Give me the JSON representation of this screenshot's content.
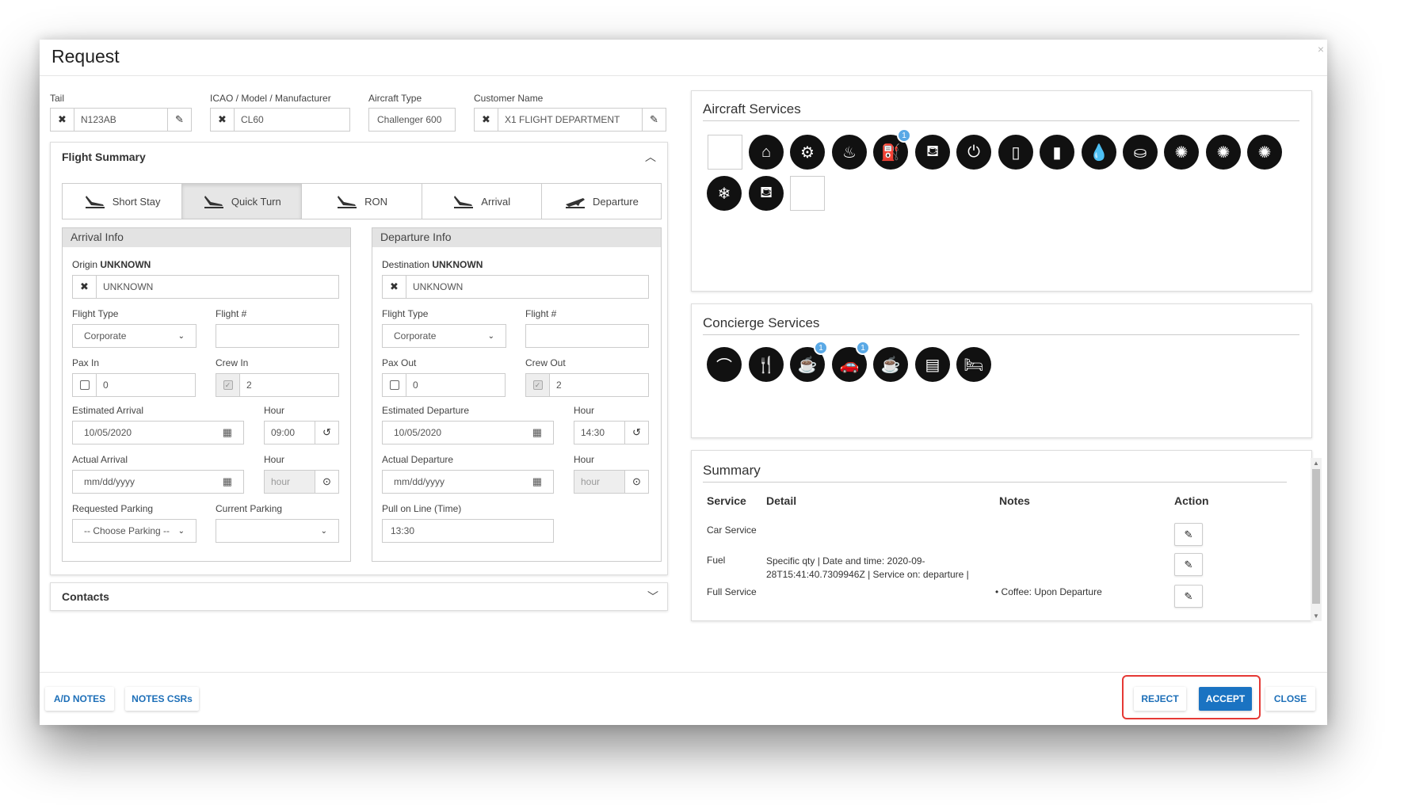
{
  "modal": {
    "title": "Request"
  },
  "top_fields": {
    "tail": {
      "label": "Tail",
      "value": "N123AB"
    },
    "icao": {
      "label": "ICAO / Model / Manufacturer",
      "value": "CL60"
    },
    "aircraft_type": {
      "label": "Aircraft Type",
      "value": "Challenger 600"
    },
    "customer": {
      "label": "Customer Name",
      "value": "X1 FLIGHT DEPARTMENT"
    }
  },
  "flight_summary": {
    "title": "Flight Summary",
    "tabs": [
      {
        "label": "Short Stay"
      },
      {
        "label": "Quick Turn"
      },
      {
        "label": "RON"
      },
      {
        "label": "Arrival"
      },
      {
        "label": "Departure"
      }
    ]
  },
  "arrival": {
    "title": "Arrival Info",
    "origin_label": "Origin",
    "origin_value": "UNKNOWN",
    "origin_input": "UNKNOWN",
    "flight_type_label": "Flight Type",
    "flight_type_value": "Corporate",
    "flight_no_label": "Flight #",
    "pax_label": "Pax In",
    "pax_value": "0",
    "crew_label": "Crew In",
    "crew_value": "2",
    "est_label": "Estimated Arrival",
    "est_value": "10/05/2020",
    "est_hour_label": "Hour",
    "est_hour_value": "09:00",
    "act_label": "Actual Arrival",
    "act_placeholder": "mm/dd/yyyy",
    "act_hour_label": "Hour",
    "act_hour_placeholder": "hour",
    "req_parking_label": "Requested Parking",
    "req_parking_value": "-- Choose Parking --",
    "cur_parking_label": "Current Parking"
  },
  "departure": {
    "title": "Departure Info",
    "dest_label": "Destination",
    "dest_value": "UNKNOWN",
    "dest_input": "UNKNOWN",
    "flight_type_label": "Flight Type",
    "flight_type_value": "Corporate",
    "flight_no_label": "Flight #",
    "pax_label": "Pax Out",
    "pax_value": "0",
    "crew_label": "Crew Out",
    "crew_value": "2",
    "est_label": "Estimated Departure",
    "est_value": "10/05/2020",
    "est_hour_label": "Hour",
    "est_hour_value": "14:30",
    "act_label": "Actual Departure",
    "act_placeholder": "mm/dd/yyyy",
    "act_hour_label": "Hour",
    "act_hour_placeholder": "hour",
    "pull_label": "Pull on Line (Time)",
    "pull_value": "13:30"
  },
  "contacts": {
    "title": "Contacts"
  },
  "aircraft_services": {
    "title": "Aircraft Services",
    "fuel_badge": "1"
  },
  "concierge_services": {
    "title": "Concierge Services",
    "badge_1": "1",
    "badge_2": "1"
  },
  "summary": {
    "title": "Summary",
    "headers": {
      "service": "Service",
      "detail": "Detail",
      "notes": "Notes",
      "action": "Action"
    },
    "rows": [
      {
        "service": "Car Service",
        "detail": "",
        "notes": ""
      },
      {
        "service": "Fuel",
        "detail": "Specific qty | Date and time: 2020-09-28T15:41:40.7309946Z | Service on: departure |",
        "notes": ""
      },
      {
        "service": "Full Service",
        "detail": "",
        "notes": "Coffee: Upon Departure"
      }
    ]
  },
  "footer": {
    "ad_notes": "A/D NOTES",
    "notes_csrs": "NOTES CSRs",
    "reject": "REJECT",
    "accept": "ACCEPT",
    "close": "CLOSE"
  },
  "colors": {
    "accent": "#1a73c2",
    "highlight": "#e53935",
    "badge": "#5aa9e6"
  }
}
